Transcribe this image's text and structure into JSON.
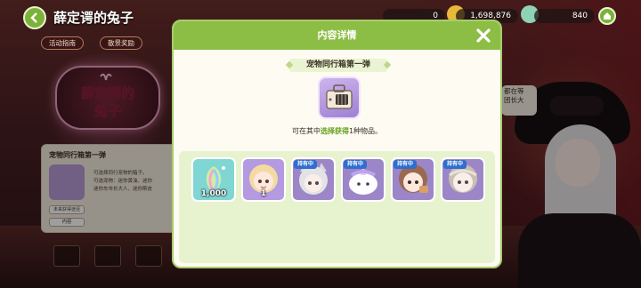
{
  "header": {
    "title": "薛定谔的兔子",
    "guide_label": "活动指南",
    "reward_label": "散景奖励",
    "resources": [
      {
        "value": "0",
        "icon": "coin-icon"
      },
      {
        "value": "1,698,876",
        "icon": "gold-coin-icon"
      },
      {
        "value": "840",
        "icon": "gem-icon"
      }
    ]
  },
  "left_panel": {
    "title": "宠物同行箱第一弹",
    "text": "可选择同行宠物的箱子。\n可选宠物：迷你黄油、迷你\n迷你车市长大人、迷你斯皮",
    "button_source": "未来获得途径",
    "button_content": "内容"
  },
  "speech": "都在等\n团长大",
  "modal": {
    "title": "内容详情",
    "box_name": "宠物同行箱第一弹",
    "desc_prefix": "可在其中",
    "desc_highlight": "选择获得",
    "desc_suffix": "1种物品。",
    "items": [
      {
        "name": "rainbow-seed",
        "icon": "rainbow-seed-icon",
        "qty": "1,000",
        "tag": "",
        "bg": "#7fd6d2"
      },
      {
        "name": "blonde-pet",
        "icon": "blonde-pet-icon",
        "qty": "1",
        "tag": "",
        "bg": "#b49ae0"
      },
      {
        "name": "silver-cat-pet",
        "icon": "silver-cat-pet-icon",
        "qty": "",
        "tag": "持有中",
        "bg": "#9c86c8"
      },
      {
        "name": "unicorn-pet",
        "icon": "unicorn-pet-icon",
        "qty": "",
        "tag": "持有中",
        "bg": "#9c86c8"
      },
      {
        "name": "brown-hair-pet",
        "icon": "brown-hair-pet-icon",
        "qty": "",
        "tag": "持有中",
        "bg": "#9c86c8"
      },
      {
        "name": "grey-hair-pet",
        "icon": "grey-hair-pet-icon",
        "qty": "",
        "tag": "持有中",
        "bg": "#9c86c8"
      }
    ]
  },
  "colors": {
    "modal_header": "#8cbe46",
    "highlight": "#63a21c",
    "owned_tag": "#2f6ecf"
  }
}
